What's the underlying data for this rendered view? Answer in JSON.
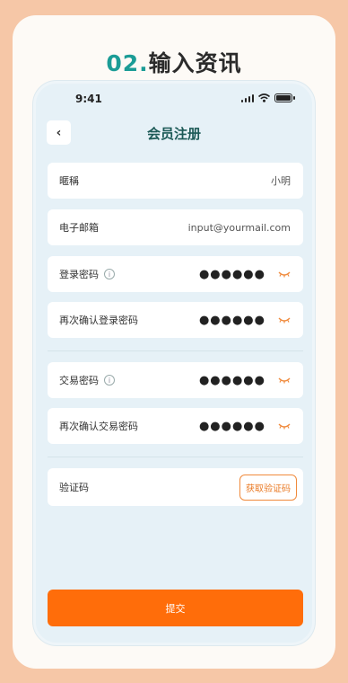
{
  "heading": {
    "step": "02.",
    "title": "输入资讯"
  },
  "status_bar": {
    "time": "9:41"
  },
  "nav": {
    "back_symbol": "‹",
    "title": "会员注册"
  },
  "fields": {
    "nickname": {
      "label": "暱稱",
      "value": "小明"
    },
    "email": {
      "label": "电子邮箱",
      "value": "input@yourmail.com"
    },
    "login_password": {
      "label": "登录密码",
      "value": "●●●●●●"
    },
    "confirm_login_password": {
      "label": "再次确认登录密码",
      "value": "●●●●●●"
    },
    "trade_password": {
      "label": "交易密码",
      "value": "●●●●●●"
    },
    "confirm_trade_password": {
      "label": "再次确认交易密码",
      "value": "●●●●●●"
    },
    "verification_code": {
      "label": "验证码",
      "button": "获取验证码"
    }
  },
  "info_symbol": "i",
  "submit_label": "提交",
  "colors": {
    "accent": "#ff6d0a",
    "teal": "#1b9c96",
    "background": "#f6c7a7"
  }
}
